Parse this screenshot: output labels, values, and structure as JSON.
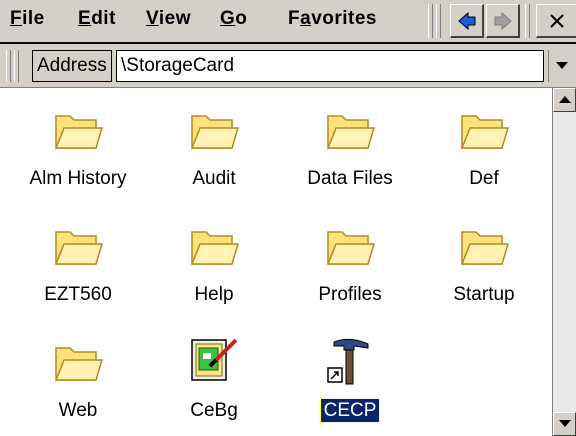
{
  "menu": {
    "file": {
      "label": "File",
      "u": "F",
      "rest": "ile"
    },
    "edit": {
      "label": "Edit",
      "u": "E",
      "rest": "dit"
    },
    "view": {
      "label": "View",
      "u": "V",
      "rest": "iew"
    },
    "go": {
      "label": "Go",
      "u": "G",
      "rest": "o"
    },
    "favorites": {
      "label": "Favorites",
      "pre": "F",
      "u": "a",
      "rest": "vorites"
    }
  },
  "toolbar": {
    "back_icon": "back-arrow-icon",
    "forward_icon": "forward-arrow-icon",
    "close_icon": "close-icon"
  },
  "address": {
    "label": "Address",
    "value": "\\StorageCard"
  },
  "items": [
    {
      "name": "Alm History",
      "icon": "folder-icon"
    },
    {
      "name": "Audit",
      "icon": "folder-icon"
    },
    {
      "name": "Data Files",
      "icon": "folder-icon"
    },
    {
      "name": "Def",
      "icon": "folder-icon"
    },
    {
      "name": "EZT560",
      "icon": "folder-icon"
    },
    {
      "name": "Help",
      "icon": "folder-icon"
    },
    {
      "name": "Profiles",
      "icon": "folder-icon"
    },
    {
      "name": "Startup",
      "icon": "folder-icon"
    },
    {
      "name": "Web",
      "icon": "folder-icon"
    },
    {
      "name": "CeBg",
      "icon": "paint-application-icon"
    },
    {
      "name": "CECP",
      "icon": "hammer-shortcut-icon",
      "selected": true
    }
  ],
  "colors": {
    "chrome": "#d4d0c8",
    "selection": "#0a246a",
    "folder": "#ffe27a",
    "back_arrow": "#1c5bd8"
  }
}
